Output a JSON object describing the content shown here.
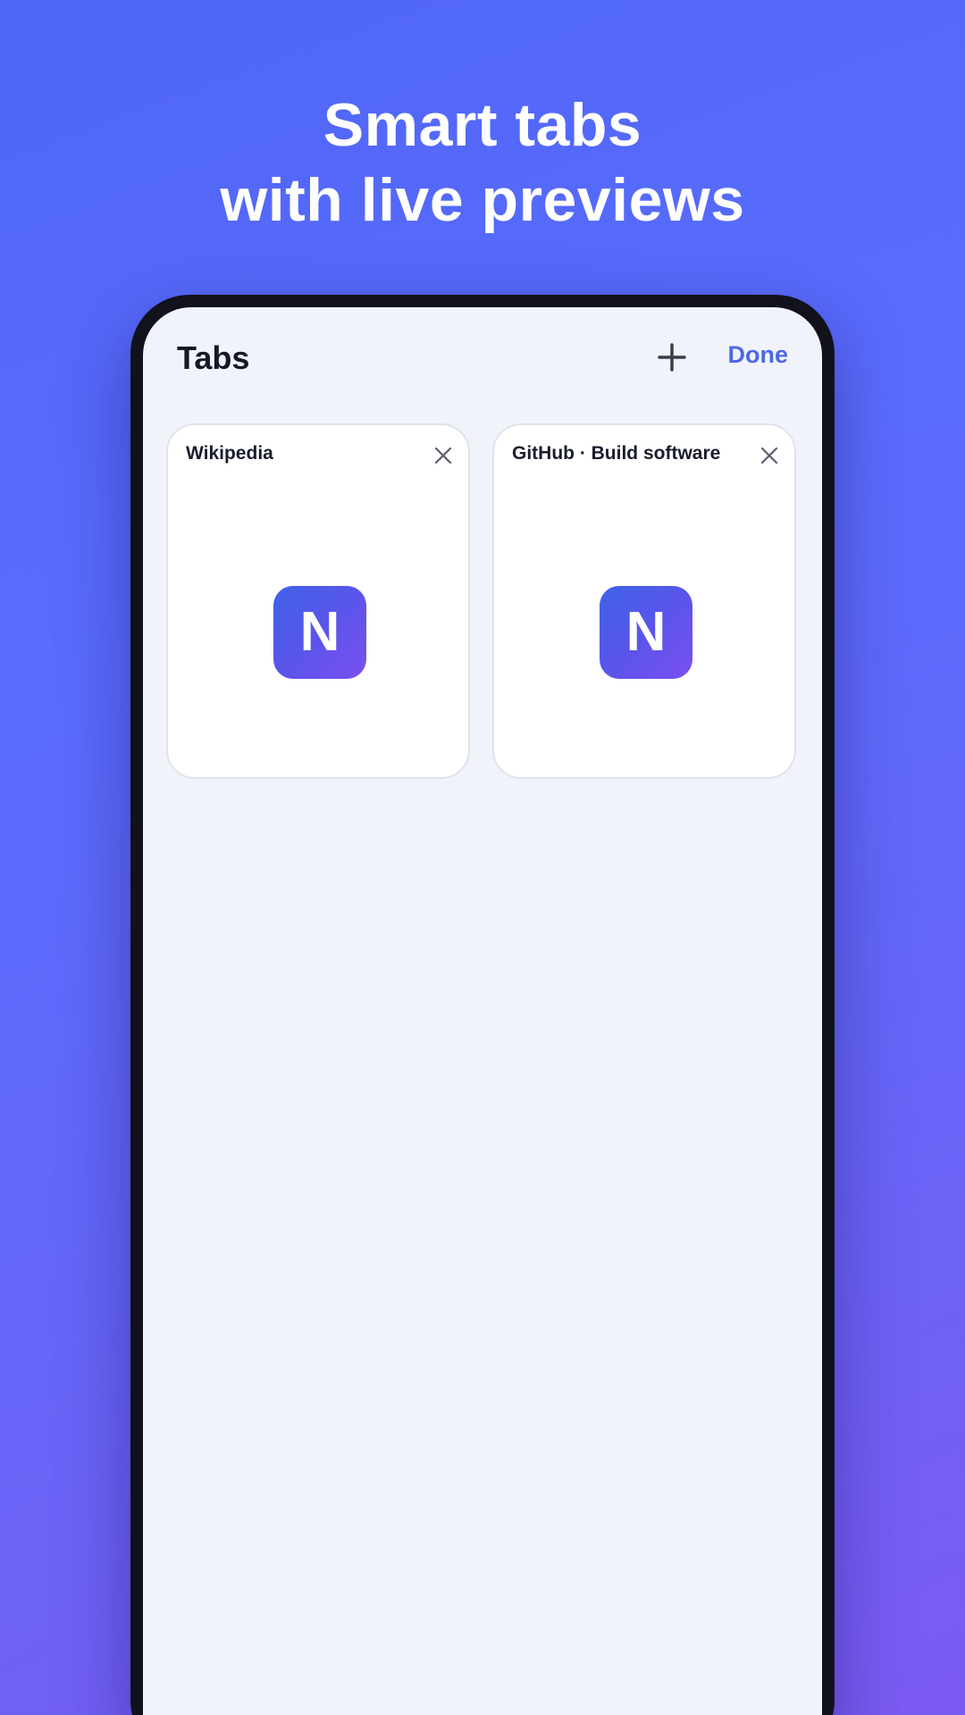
{
  "headline": {
    "line1": "Smart tabs",
    "line2": "with live previews"
  },
  "header": {
    "title": "Tabs",
    "add_icon": "plus-icon",
    "done_label": "Done"
  },
  "tabs": [
    {
      "title": "Wikipedia",
      "favicon_letter": "N",
      "close_icon": "close-icon"
    },
    {
      "title": "GitHub · Build software",
      "favicon_letter": "N",
      "close_icon": "close-icon"
    }
  ],
  "colors": {
    "accent": "#4d68e6",
    "screen_bg": "#f1f3fa",
    "favicon_gradient_start": "#3f63e8",
    "favicon_gradient_end": "#7b4ff0"
  }
}
